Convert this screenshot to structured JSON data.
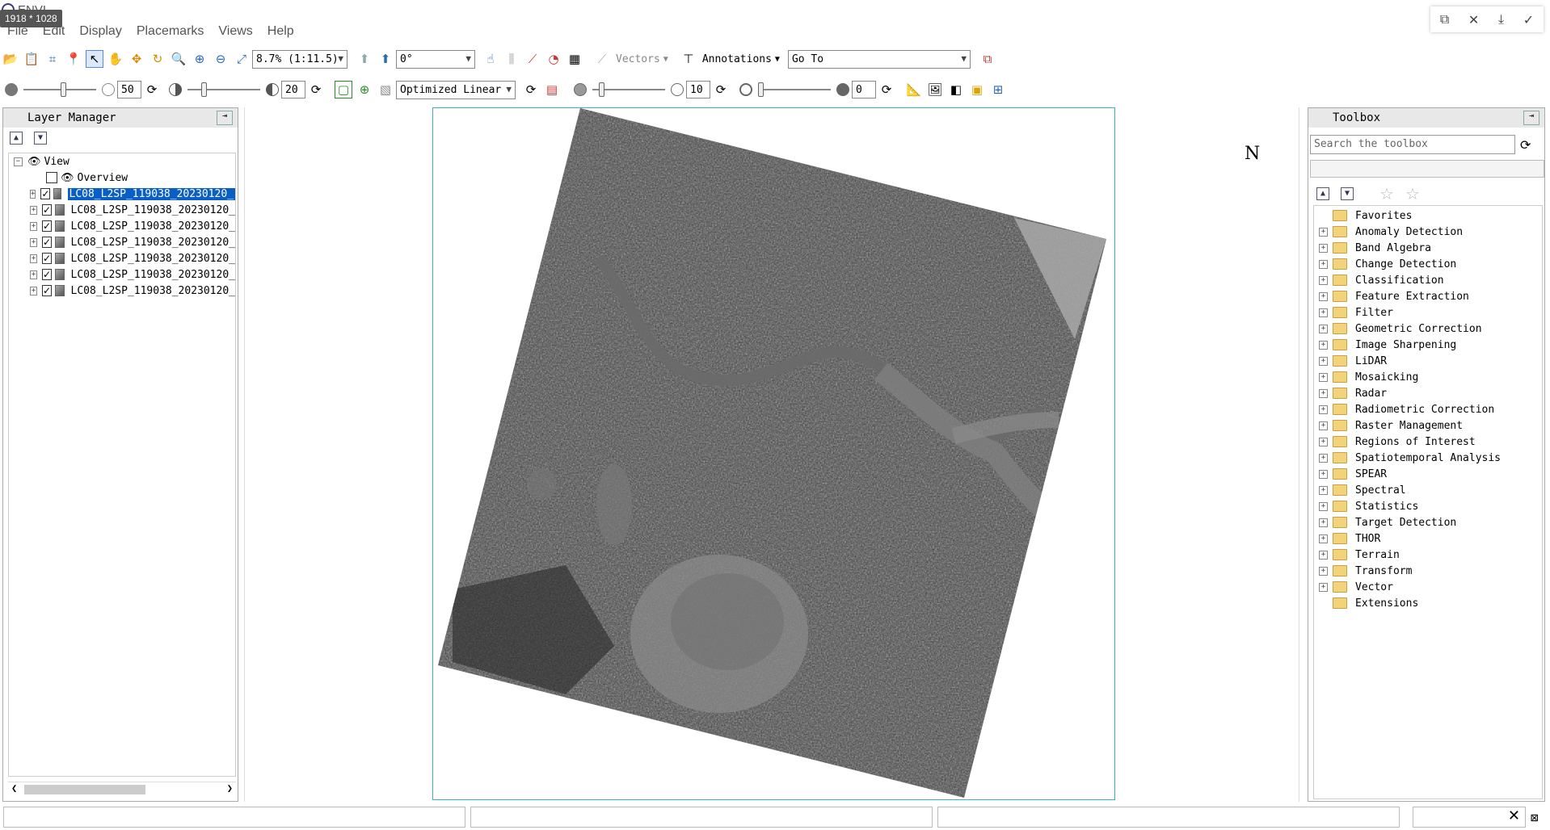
{
  "window": {
    "title": "ENVI",
    "dimensions_badge": "1918 * 1028"
  },
  "menu": [
    "File",
    "Edit",
    "Display",
    "Placemarks",
    "Views",
    "Help"
  ],
  "toolbar1": {
    "zoom_value": "8.7% (1:11.5)",
    "rotation_value": "0°",
    "vectors_label": "Vectors",
    "annotations_label": "Annotations",
    "goto_value": "Go To"
  },
  "toolbar2": {
    "brightness_value": "50",
    "contrast_value": "20",
    "stretch_value": "Optimized Linear",
    "sharpen_value": "10",
    "transparency_value": "0",
    "brightness_level_pct": 0.55,
    "contrast_level_pct": 0.2,
    "sharpen_level_pct": 0.1,
    "transparency_level_pct": 0.0
  },
  "layer_manager": {
    "title": "Layer Manager",
    "root": "View",
    "overview": "Overview",
    "layers": [
      "LC08_L2SP_119038_20230120_",
      "LC08_L2SP_119038_20230120_",
      "LC08_L2SP_119038_20230120_",
      "LC08_L2SP_119038_20230120_",
      "LC08_L2SP_119038_20230120_",
      "LC08_L2SP_119038_20230120_",
      "LC08_L2SP_119038_20230120_"
    ]
  },
  "view": {
    "north_label": "N"
  },
  "toolbox": {
    "title": "Toolbox",
    "search_placeholder": "Search the toolbox",
    "items": [
      "Favorites",
      "Anomaly Detection",
      "Band Algebra",
      "Change Detection",
      "Classification",
      "Feature Extraction",
      "Filter",
      "Geometric Correction",
      "Image Sharpening",
      "LiDAR",
      "Mosaicking",
      "Radar",
      "Radiometric Correction",
      "Raster Management",
      "Regions of Interest",
      "Spatiotemporal Analysis",
      "SPEAR",
      "Spectral",
      "Statistics",
      "Target Detection",
      "THOR",
      "Terrain",
      "Transform",
      "Vector",
      "Extensions"
    ]
  },
  "colors": {
    "selection": "#0a5fc7",
    "view_frame": "#39b3c0",
    "folder": "#f2d27a"
  }
}
